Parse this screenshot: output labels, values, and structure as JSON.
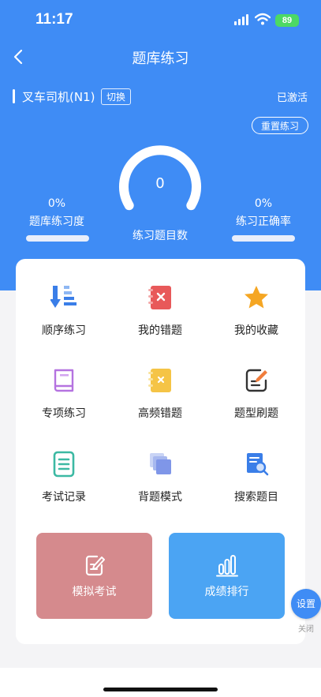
{
  "status_bar": {
    "time": "11:17",
    "battery": "89"
  },
  "header": {
    "title": "题库练习"
  },
  "vehicle": {
    "name": "叉车司机(N1)",
    "switch_label": "切换",
    "status": "已激活"
  },
  "reset_label": "重置练习",
  "stats": {
    "bank_progress": {
      "value": "0%",
      "label": "题库练习度",
      "fraction": 0
    },
    "count": {
      "value": "0",
      "label": "练习题目数"
    },
    "accuracy": {
      "value": "0%",
      "label": "练习正确率",
      "fraction": 0
    }
  },
  "grid": [
    {
      "label": "顺序练习",
      "icon": "sequence-icon"
    },
    {
      "label": "我的错题",
      "icon": "wrong-questions-icon"
    },
    {
      "label": "我的收藏",
      "icon": "star-icon"
    },
    {
      "label": "专项练习",
      "icon": "book-icon"
    },
    {
      "label": "高频错题",
      "icon": "frequent-errors-icon"
    },
    {
      "label": "题型刷题",
      "icon": "edit-document-icon"
    },
    {
      "label": "考试记录",
      "icon": "record-list-icon"
    },
    {
      "label": "背题模式",
      "icon": "cards-icon"
    },
    {
      "label": "搜索题目",
      "icon": "search-document-icon"
    }
  ],
  "buttons": {
    "mock_exam": {
      "label": "模拟考试",
      "color": "#d58a8d",
      "icon": "pencil-note-icon"
    },
    "ranking": {
      "label": "成绩排行",
      "color": "#4ba4f3",
      "icon": "bar-chart-icon"
    }
  },
  "floating": {
    "settings_label": "设置",
    "close_label": "关闭"
  },
  "colors": {
    "primary": "#3f8cf5",
    "mock_exam": "#d58a8d",
    "ranking": "#4ba4f3"
  }
}
